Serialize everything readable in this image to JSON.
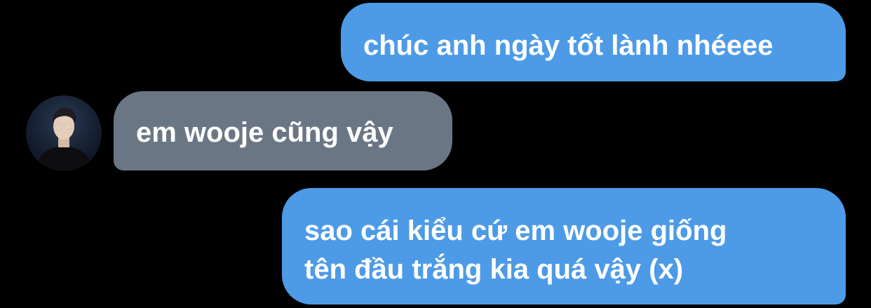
{
  "messages": [
    {
      "direction": "sent",
      "text": "chúc anh ngày tốt lành nhéeee"
    },
    {
      "direction": "received",
      "text": "em wooje cũng vậy"
    },
    {
      "direction": "sent",
      "text": "sao cái kiểu cứ em wooje giống\ntên đầu trắng kia quá vậy (x)"
    }
  ],
  "colors": {
    "background": "#000000",
    "sent_bubble": "#4d9be7",
    "received_bubble": "#6b7685",
    "text": "#ffffff"
  },
  "icons": {
    "avatar": "profile-photo-avatar"
  }
}
